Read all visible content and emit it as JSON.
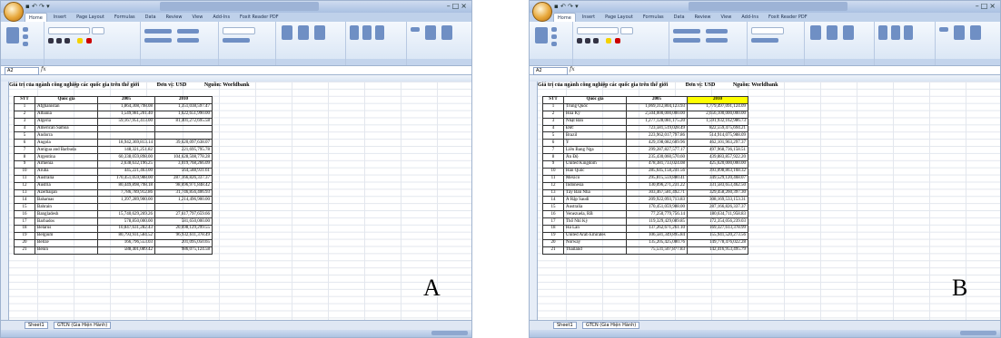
{
  "ribbon_tabs": [
    "Home",
    "Insert",
    "Page Layout",
    "Formulas",
    "Data",
    "Review",
    "View",
    "Add-Ins",
    "Foxit Reader PDF"
  ],
  "name_box": "A2",
  "fx_label": "fx",
  "panel_a": {
    "label": "A",
    "heading": [
      "Giá trị của ngành công nghiệp các quốc gia trên thế giới",
      "Đơn vị: USD",
      "Nguồn: Worldbank"
    ],
    "headers": {
      "stt": "STT",
      "country": "Quốc gia",
      "y2005": "2005",
      "y2010": "2010"
    },
    "rows": [
      [
        "1",
        "Afghanistan",
        "1,864,308,798.08",
        "1,351,038,597.47"
      ],
      [
        "2",
        "Albania",
        "1,549,981,201.40",
        "1,622,651,990.00"
      ],
      [
        "3",
        "Algeria",
        "59,167,951,413.00",
        "81,401,272,695.58"
      ],
      [
        "4",
        "American Samoa",
        "",
        ""
      ],
      [
        "5",
        "Andorra",
        "",
        ""
      ],
      [
        "6",
        "Angola",
        "18,942,369,813.14",
        "39,620,097,638.07"
      ],
      [
        "7",
        "Antigua and Barbuda",
        "148,321,251.82",
        "221,695,795.78"
      ],
      [
        "8",
        "Argentina",
        "60,338,059,898.00",
        "104,628,508,778.28"
      ],
      [
        "9",
        "Armenia",
        "2,638,632,196.25",
        "3,019,768,266.09"
      ],
      [
        "10",
        "Aruba",
        "445,221,463.00",
        "564,588,931.61"
      ],
      [
        "11",
        "Australia",
        "170,451,059,988.00",
        "287,166,826,337.37"
      ],
      [
        "12",
        "Austria",
        "80,449,898,798.18",
        "98,696,971,848.42"
      ],
      [
        "13",
        "Azerbaijan",
        "7,786,789,912.86",
        "31,746,856,406.93"
      ],
      [
        "14",
        "Bahamas",
        "1,397,289,900.00",
        "1,214,496,900.00"
      ],
      [
        "15",
        "Bahrain",
        "",
        ""
      ],
      [
        "16",
        "Bangladesh",
        "15,740,629,269.26",
        "27,617,797,659.66"
      ],
      [
        "17",
        "Barbados",
        "578,850,000.00",
        "581,650,000.00"
      ],
      [
        "18",
        "Belarus",
        "10,847,631,282.43",
        "20,698,129,299.55"
      ],
      [
        "19",
        "Belgium",
        "80,793,931,584.52",
        "96,932,611,378.49"
      ],
      [
        "20",
        "Belize",
        "166,796,553.03",
        "201,095,050.65"
      ],
      [
        "21",
        "Benin",
        "588,401,089.42",
        "986,075,124.58"
      ]
    ],
    "sheet_tabs": [
      "Sheet1",
      "GTCN (Gia Hiện Hành)"
    ]
  },
  "panel_b": {
    "label": "B",
    "heading": [
      "Giá trị của ngành công nghiệp các quốc gia trên thế giới",
      "Đơn vị: USD",
      "Nguồn: Worldbank"
    ],
    "headers": {
      "stt": "STT",
      "country": "Quốc gia",
      "y2005": "2005",
      "y2010": "2010"
    },
    "rows": [
      [
        "1",
        "Trung Quốc",
        "1,069,312,804,123.93",
        "1,779,497,091,124.09"
      ],
      [
        "2",
        "Hoa Kỳ",
        "2,504,000,000,000.00",
        "2,656,100,000,000.00"
      ],
      [
        "3",
        "Nhật Bản",
        "1,277,128,081,175.20",
        "1,591,932,162,986.73"
      ],
      [
        "4",
        "Đức",
        "723,581,519,028.49",
        "822,559,475,694.21"
      ],
      [
        "5",
        "Brazil",
        "223,962,017,797.86",
        "514,914,075,988.09"
      ],
      [
        "6",
        "Ý",
        "429,198,082,609.96",
        "462,101,963,297.37"
      ],
      [
        "7",
        "Liên Bang Nga",
        "299,287,827,577.17",
        "497,968,736,158.51"
      ],
      [
        "8",
        "Ấn Độ",
        "235,430,060,570.60",
        "439,883,857,922.20"
      ],
      [
        "9",
        "United Kingdom",
        "478,381,733,024.08",
        "425,620,000,000.00"
      ],
      [
        "10",
        "Hàn Quốc",
        "285,645,158,241.56",
        "393,098,863,168.32"
      ],
      [
        "11",
        "Mexico",
        "295,815,559,880.41",
        "349,529,120,468.07"
      ],
      [
        "12",
        "Indonesia",
        "130,096,271,231.22",
        "331,583,653,462.50"
      ],
      [
        "13",
        "Tây Ban Nha",
        "303,467,581,492.71",
        "329,458,260,397.30"
      ],
      [
        "14",
        "Ả Rập Saudi",
        "209,922,093,713.83",
        "308,169,533,153.31"
      ],
      [
        "15",
        "Australia",
        "170,451,059,988.00",
        "287,166,826,337.37"
      ],
      [
        "16",
        "Venezuela, RB",
        "77,250,779,756.14",
        "180,634,711,958.83"
      ],
      [
        "17",
        "Thổ Nhĩ Kỳ",
        "119,329,429,089.85",
        "172,354,056,239.03"
      ],
      [
        "18",
        "Hà Lan",
        "137,262,671,261.10",
        "169,327,613,378.99"
      ],
      [
        "19",
        "United Arab Emirates",
        "106,581,349,895.84",
        "155,941,520,273.56"
      ],
      [
        "20",
        "Norway",
        "135,205,425,080.76",
        "149,778,476,022.28"
      ],
      [
        "21",
        "Thailand",
        "75,531,507,877.83",
        "142,416,953,495.79"
      ]
    ],
    "sheet_tabs": [
      "Sheet1",
      "GTCN (Gia Hiện Hành)"
    ]
  }
}
